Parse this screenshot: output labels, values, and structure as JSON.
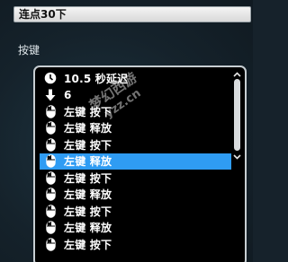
{
  "header": {
    "title": "连点30下"
  },
  "section": {
    "label": "按键"
  },
  "list": {
    "items": [
      {
        "icon": "clock-icon",
        "label": "10.5 秒延迟",
        "selected": false
      },
      {
        "icon": "down-arrow-icon",
        "label": "6",
        "selected": false
      },
      {
        "icon": "mouse-icon",
        "label": "左键 按下",
        "selected": false
      },
      {
        "icon": "mouse-icon",
        "label": "左键 释放",
        "selected": false
      },
      {
        "icon": "mouse-icon",
        "label": "左键 按下",
        "selected": false
      },
      {
        "icon": "mouse-icon",
        "label": "左键 释放",
        "selected": true
      },
      {
        "icon": "mouse-icon",
        "label": "左键 按下",
        "selected": false
      },
      {
        "icon": "mouse-icon",
        "label": "左键 释放",
        "selected": false
      },
      {
        "icon": "mouse-icon",
        "label": "左键 按下",
        "selected": false
      },
      {
        "icon": "mouse-icon",
        "label": "左键 释放",
        "selected": false
      },
      {
        "icon": "mouse-icon",
        "label": "左键 按下",
        "selected": false
      }
    ]
  },
  "watermark": {
    "line1": "梦幻西游",
    "line2": "yzz.cn"
  },
  "colors": {
    "selection": "#2f9cf3",
    "list_background": "#000000",
    "text": "#ffffff"
  }
}
